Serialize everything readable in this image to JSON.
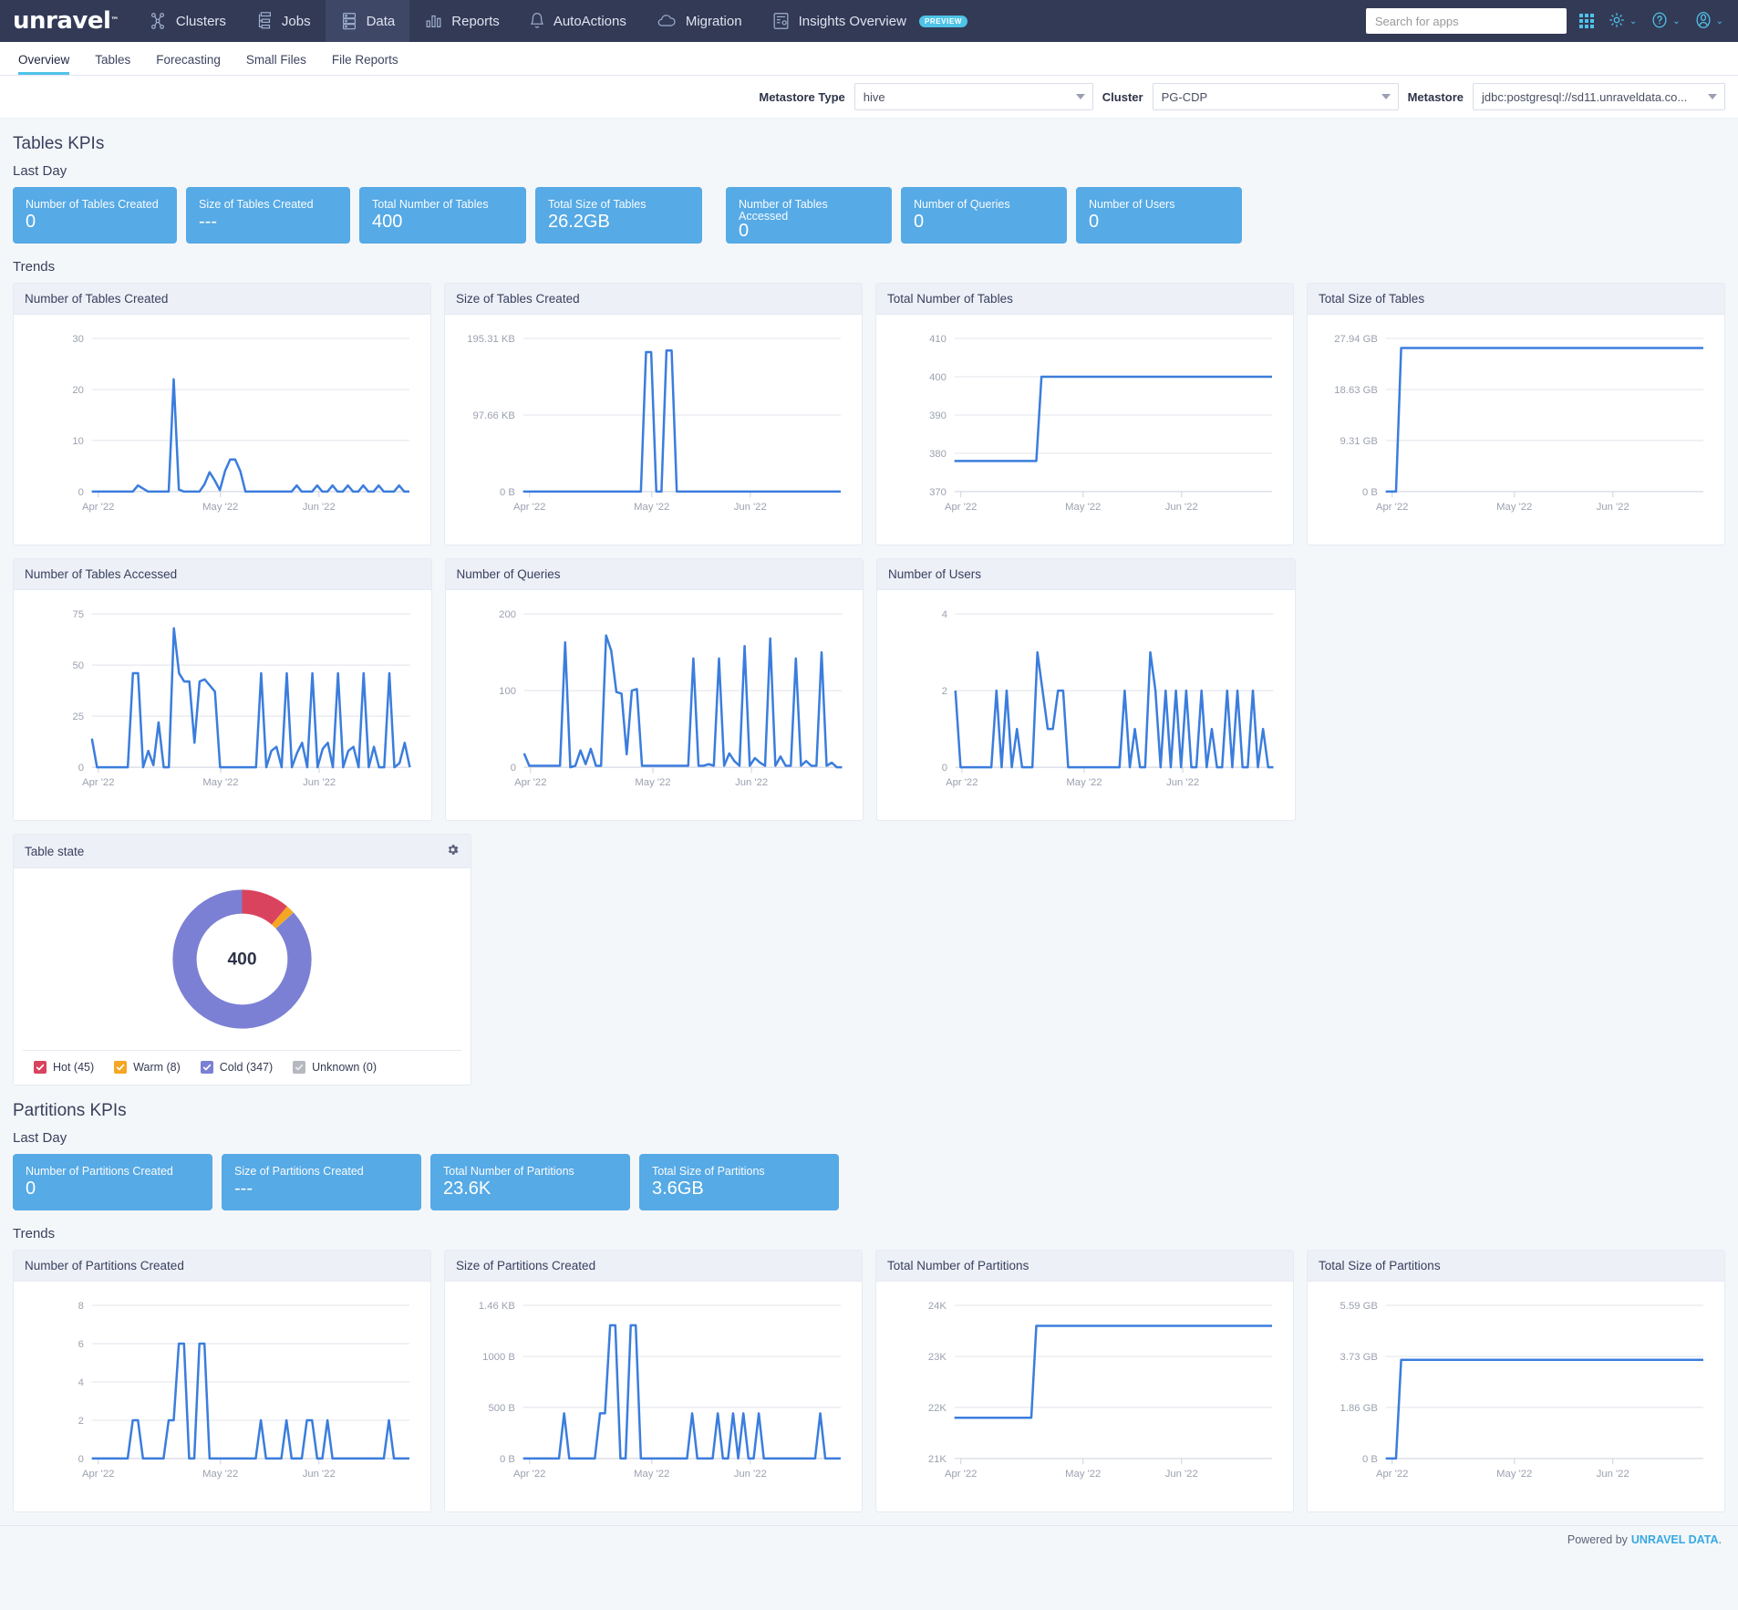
{
  "topnav": {
    "brand": "unravel",
    "brand_tm": "™",
    "items": [
      {
        "label": "Clusters",
        "icon": "clusters-icon",
        "active": false
      },
      {
        "label": "Jobs",
        "icon": "jobs-icon",
        "active": false
      },
      {
        "label": "Data",
        "icon": "data-icon",
        "active": true
      },
      {
        "label": "Reports",
        "icon": "reports-icon",
        "active": false
      },
      {
        "label": "AutoActions",
        "icon": "bell-icon",
        "active": false
      },
      {
        "label": "Migration",
        "icon": "cloud-icon",
        "active": false
      },
      {
        "label": "Insights Overview",
        "icon": "insights-icon",
        "active": false,
        "badge": "PREVIEW"
      }
    ],
    "search_placeholder": "Search for apps",
    "right_icons": [
      "apps-grid-icon",
      "settings-gear-icon",
      "help-icon",
      "user-avatar-icon"
    ]
  },
  "subnav": {
    "tabs": [
      {
        "label": "Overview",
        "active": true
      },
      {
        "label": "Tables",
        "active": false
      },
      {
        "label": "Forecasting",
        "active": false
      },
      {
        "label": "Small Files",
        "active": false
      },
      {
        "label": "File Reports",
        "active": false
      }
    ]
  },
  "filters": {
    "metastore_type_label": "Metastore Type",
    "metastore_type_value": "hive",
    "cluster_label": "Cluster",
    "cluster_value": "PG-CDP",
    "metastore_label": "Metastore",
    "metastore_value": "jdbc:postgresql://sd11.unraveldata.co..."
  },
  "tables_section": {
    "title": "Tables KPIs",
    "subtitle": "Last Day",
    "trends_label": "Trends",
    "kpis": [
      {
        "label": "Number of Tables Created",
        "value": "0"
      },
      {
        "label": "Size of Tables Created",
        "value": "---"
      },
      {
        "label": "Total Number of Tables",
        "value": "400"
      },
      {
        "label": "Total Size of Tables",
        "value": "26.2GB"
      },
      {
        "label": "Number of Tables Accessed",
        "value": "0"
      },
      {
        "label": "Number of Queries",
        "value": "0"
      },
      {
        "label": "Number of Users",
        "value": "0"
      }
    ]
  },
  "partitions_section": {
    "title": "Partitions KPIs",
    "subtitle": "Last Day",
    "trends_label": "Trends",
    "kpis": [
      {
        "label": "Number of Partitions Created",
        "value": "0"
      },
      {
        "label": "Size of Partitions Created",
        "value": "---"
      },
      {
        "label": "Total Number of Partitions",
        "value": "23.6K"
      },
      {
        "label": "Total Size of Partitions",
        "value": "3.6GB"
      }
    ]
  },
  "table_state": {
    "title": "Table state",
    "gear_icon": "gear-icon",
    "center_total": "400",
    "legend": [
      {
        "label": "Hot (45)",
        "color": "#d9435e",
        "checked": true,
        "value": 45
      },
      {
        "label": "Warm (8)",
        "color": "#f5a623",
        "checked": true,
        "value": 8
      },
      {
        "label": "Cold (347)",
        "color": "#7b80d4",
        "checked": true,
        "value": 347
      },
      {
        "label": "Unknown (0)",
        "color": "#b5b8bf",
        "checked": true,
        "value": 0
      }
    ]
  },
  "footer": {
    "powered_by": "Powered by",
    "company": "UNRAVEL DATA",
    "period": "."
  },
  "chart_data": [
    {
      "id": "tables-created",
      "type": "line",
      "title": "Number of Tables Created",
      "xlabel": "",
      "ylabel": "",
      "ytick_labels": [
        "0",
        "10",
        "20",
        "30"
      ],
      "ylim": [
        0,
        30
      ],
      "xtick_labels": [
        "Apr '22",
        "May '22",
        "Jun '22"
      ],
      "xtick_positions": [
        0.02,
        0.41,
        0.72
      ],
      "grid": true,
      "color": "#3b7ddd",
      "values": [
        0,
        0,
        0,
        0,
        0,
        0,
        0,
        0,
        0,
        1.2,
        0.6,
        0,
        0,
        0,
        0,
        0,
        22,
        0.4,
        0,
        0,
        0,
        0,
        1.4,
        3.8,
        2.2,
        0.3,
        4,
        6.3,
        6.3,
        4,
        0,
        0,
        0,
        0,
        0,
        0,
        0,
        0,
        0,
        0,
        1.2,
        0,
        0,
        0,
        1.2,
        0,
        0,
        1.2,
        0,
        0,
        1.2,
        0,
        0,
        1.2,
        0,
        0,
        1.2,
        0,
        0,
        0,
        1.2,
        0,
        0
      ]
    },
    {
      "id": "size-tables-created",
      "type": "line",
      "title": "Size of Tables Created",
      "ytick_labels": [
        "0 B",
        "97.66 KB",
        "195.31 KB"
      ],
      "ylim": [
        0,
        195.31
      ],
      "yunit": "KB",
      "xtick_labels": [
        "Apr '22",
        "May '22",
        "Jun '22"
      ],
      "grid": true,
      "color": "#3b7ddd",
      "values": [
        0,
        0,
        0,
        0,
        0,
        0,
        0,
        0,
        0,
        0,
        0,
        0,
        0,
        0,
        0,
        0,
        0,
        0,
        0,
        0,
        0,
        0,
        0,
        0,
        178,
        178,
        0,
        0,
        180,
        180,
        0,
        0,
        0,
        0,
        0,
        0,
        0,
        0,
        0,
        0,
        0,
        0,
        0,
        0,
        0,
        0,
        0,
        0,
        0,
        0,
        0,
        0,
        0,
        0,
        0,
        0,
        0,
        0,
        0,
        0,
        0,
        0,
        0
      ]
    },
    {
      "id": "total-number-tables",
      "type": "line",
      "title": "Total Number of Tables",
      "ytick_labels": [
        "370",
        "380",
        "390",
        "400",
        "410"
      ],
      "ylim": [
        370,
        410
      ],
      "xtick_labels": [
        "Apr '22",
        "May '22",
        "Jun '22"
      ],
      "grid": true,
      "color": "#3b7ddd",
      "values": [
        378,
        378,
        378,
        378,
        378,
        378,
        378,
        378,
        378,
        378,
        378,
        378,
        378,
        378,
        378,
        378,
        378,
        400,
        400,
        400,
        400,
        400,
        400,
        400,
        400,
        400,
        400,
        400,
        400,
        400,
        400,
        400,
        400,
        400,
        400,
        400,
        400,
        400,
        400,
        400,
        400,
        400,
        400,
        400,
        400,
        400,
        400,
        400,
        400,
        400,
        400,
        400,
        400,
        400,
        400,
        400,
        400,
        400,
        400,
        400,
        400,
        400,
        400
      ]
    },
    {
      "id": "total-size-tables",
      "type": "line",
      "title": "Total Size of Tables",
      "ytick_labels": [
        "0 B",
        "9.31 GB",
        "18.63 GB",
        "27.94 GB"
      ],
      "ylim": [
        0,
        27.94
      ],
      "yunit": "GB",
      "xtick_labels": [
        "Apr '22",
        "May '22",
        "Jun '22"
      ],
      "grid": true,
      "color": "#3b7ddd",
      "values": [
        0,
        0,
        0,
        26.2,
        26.2,
        26.2,
        26.2,
        26.2,
        26.2,
        26.2,
        26.2,
        26.2,
        26.2,
        26.2,
        26.2,
        26.2,
        26.2,
        26.2,
        26.2,
        26.2,
        26.2,
        26.2,
        26.2,
        26.2,
        26.2,
        26.2,
        26.2,
        26.2,
        26.2,
        26.2,
        26.2,
        26.2,
        26.2,
        26.2,
        26.2,
        26.2,
        26.2,
        26.2,
        26.2,
        26.2,
        26.2,
        26.2,
        26.2,
        26.2,
        26.2,
        26.2,
        26.2,
        26.2,
        26.2,
        26.2,
        26.2,
        26.2,
        26.2,
        26.2,
        26.2,
        26.2,
        26.2,
        26.2,
        26.2,
        26.2,
        26.2,
        26.2,
        26.2
      ]
    },
    {
      "id": "tables-accessed",
      "type": "line",
      "title": "Number of Tables Accessed",
      "ytick_labels": [
        "0",
        "25",
        "50",
        "75"
      ],
      "ylim": [
        0,
        75
      ],
      "xtick_labels": [
        "Apr '22",
        "May '22",
        "Jun '22"
      ],
      "grid": true,
      "color": "#3b7ddd",
      "values": [
        14,
        0,
        0,
        0,
        0,
        0,
        0,
        0,
        46,
        46,
        0,
        8,
        1,
        22,
        0,
        0,
        68,
        46,
        42,
        42,
        12,
        42,
        43,
        40,
        37,
        0,
        0,
        0,
        0,
        0,
        0,
        0,
        0,
        46,
        0,
        8,
        10,
        0,
        46,
        0,
        7,
        12,
        0,
        46,
        0,
        9,
        12,
        0,
        46,
        0,
        8,
        10,
        0,
        46,
        0,
        10,
        0,
        0,
        46,
        0,
        2,
        12,
        0
      ]
    },
    {
      "id": "number-queries",
      "type": "line",
      "title": "Number of Queries",
      "ytick_labels": [
        "0",
        "100",
        "200"
      ],
      "ylim": [
        0,
        200
      ],
      "xtick_labels": [
        "Apr '22",
        "May '22",
        "Jun '22"
      ],
      "grid": true,
      "color": "#3b7ddd",
      "values": [
        18,
        2,
        2,
        2,
        2,
        2,
        2,
        2,
        163,
        0,
        2,
        22,
        4,
        24,
        2,
        2,
        172,
        152,
        98,
        96,
        17,
        100,
        102,
        2,
        2,
        2,
        2,
        2,
        2,
        2,
        2,
        2,
        2,
        142,
        2,
        2,
        4,
        2,
        142,
        2,
        18,
        8,
        2,
        158,
        2,
        12,
        6,
        2,
        168,
        2,
        14,
        2,
        2,
        142,
        2,
        8,
        2,
        2,
        150,
        2,
        6,
        0,
        0
      ]
    },
    {
      "id": "number-users",
      "type": "line",
      "title": "Number of Users",
      "ytick_labels": [
        "0",
        "2",
        "4"
      ],
      "ylim": [
        0,
        4
      ],
      "xtick_labels": [
        "Apr '22",
        "May '22",
        "Jun '22"
      ],
      "grid": true,
      "color": "#3b7ddd",
      "values": [
        2,
        0,
        0,
        0,
        0,
        0,
        0,
        0,
        2,
        0,
        2,
        0,
        1,
        0,
        0,
        0,
        3,
        2,
        1,
        1,
        2,
        2,
        0,
        0,
        0,
        0,
        0,
        0,
        0,
        0,
        0,
        0,
        0,
        2,
        0,
        1,
        0,
        0,
        3,
        2,
        0,
        2,
        0,
        2,
        0,
        2,
        0,
        0,
        2,
        0,
        1,
        0,
        0,
        2,
        0,
        2,
        0,
        0,
        2,
        0,
        1,
        0,
        0
      ]
    },
    {
      "id": "partitions-created",
      "type": "line",
      "title": "Number of Partitions Created",
      "ytick_labels": [
        "0",
        "2",
        "4",
        "6",
        "8"
      ],
      "ylim": [
        0,
        8
      ],
      "xtick_labels": [
        "Apr '22",
        "May '22",
        "Jun '22"
      ],
      "grid": true,
      "color": "#3b7ddd",
      "values": [
        0,
        0,
        0,
        0,
        0,
        0,
        0,
        0,
        2,
        2,
        0,
        0,
        0,
        0,
        0,
        2,
        2,
        6,
        6,
        0,
        0,
        6,
        6,
        0,
        0,
        0,
        0,
        0,
        0,
        0,
        0,
        0,
        0,
        2,
        0,
        0,
        0,
        0,
        2,
        0,
        0,
        0,
        2,
        2,
        0,
        0,
        2,
        0,
        0,
        0,
        0,
        0,
        0,
        0,
        0,
        0,
        0,
        0,
        2,
        0,
        0,
        0,
        0
      ]
    },
    {
      "id": "size-partitions-created",
      "type": "line",
      "title": "Size of Partitions Created",
      "ytick_labels": [
        "0 B",
        "500 B",
        "1000 B",
        "1.46 KB"
      ],
      "ylim": [
        0,
        1460
      ],
      "xtick_labels": [
        "Apr '22",
        "May '22",
        "Jun '22"
      ],
      "grid": true,
      "color": "#3b7ddd",
      "values": [
        0,
        0,
        0,
        0,
        0,
        0,
        0,
        0,
        430,
        0,
        0,
        0,
        0,
        0,
        0,
        430,
        430,
        1270,
        1270,
        0,
        0,
        1270,
        1270,
        0,
        0,
        0,
        0,
        0,
        0,
        0,
        0,
        0,
        0,
        430,
        0,
        0,
        0,
        0,
        430,
        0,
        0,
        430,
        0,
        430,
        0,
        0,
        430,
        0,
        0,
        0,
        0,
        0,
        0,
        0,
        0,
        0,
        0,
        0,
        430,
        0,
        0,
        0,
        0
      ]
    },
    {
      "id": "total-number-partitions",
      "type": "line",
      "title": "Total Number of Partitions",
      "ytick_labels": [
        "21K",
        "22K",
        "23K",
        "24K"
      ],
      "ylim": [
        21000,
        24000
      ],
      "xtick_labels": [
        "Apr '22",
        "May '22",
        "Jun '22"
      ],
      "grid": true,
      "color": "#3b7ddd",
      "values": [
        21800,
        21800,
        21800,
        21800,
        21800,
        21800,
        21800,
        21800,
        21800,
        21800,
        21800,
        21800,
        21800,
        21800,
        21800,
        21800,
        23600,
        23600,
        23600,
        23600,
        23600,
        23600,
        23600,
        23600,
        23600,
        23600,
        23600,
        23600,
        23600,
        23600,
        23600,
        23600,
        23600,
        23600,
        23600,
        23600,
        23600,
        23600,
        23600,
        23600,
        23600,
        23600,
        23600,
        23600,
        23600,
        23600,
        23600,
        23600,
        23600,
        23600,
        23600,
        23600,
        23600,
        23600,
        23600,
        23600,
        23600,
        23600,
        23600,
        23600,
        23600,
        23600,
        23600
      ]
    },
    {
      "id": "total-size-partitions",
      "type": "line",
      "title": "Total Size of Partitions",
      "ytick_labels": [
        "0 B",
        "1.86 GB",
        "3.73 GB",
        "5.59 GB"
      ],
      "ylim": [
        0,
        5.59
      ],
      "yunit": "GB",
      "xtick_labels": [
        "Apr '22",
        "May '22",
        "Jun '22"
      ],
      "grid": true,
      "color": "#3b7ddd",
      "values": [
        0,
        0,
        0,
        3.6,
        3.6,
        3.6,
        3.6,
        3.6,
        3.6,
        3.6,
        3.6,
        3.6,
        3.6,
        3.6,
        3.6,
        3.6,
        3.6,
        3.6,
        3.6,
        3.6,
        3.6,
        3.6,
        3.6,
        3.6,
        3.6,
        3.6,
        3.6,
        3.6,
        3.6,
        3.6,
        3.6,
        3.6,
        3.6,
        3.6,
        3.6,
        3.6,
        3.6,
        3.6,
        3.6,
        3.6,
        3.6,
        3.6,
        3.6,
        3.6,
        3.6,
        3.6,
        3.6,
        3.6,
        3.6,
        3.6,
        3.6,
        3.6,
        3.6,
        3.6,
        3.6,
        3.6,
        3.6,
        3.6,
        3.6,
        3.6,
        3.6,
        3.6,
        3.6
      ]
    }
  ]
}
